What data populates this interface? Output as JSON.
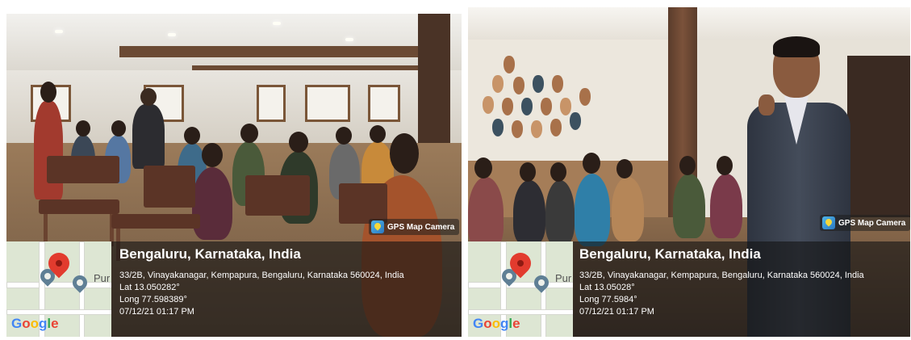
{
  "photos": [
    {
      "gps_tag": "GPS Map Camera",
      "city": "Bengaluru, Karnataka, India",
      "address": "33/2B, Vinayakanagar, Kempapura, Bengaluru, Karnataka 560024, India",
      "lat": "Lat 13.050282°",
      "long": "Long 77.598389°",
      "datetime": "07/12/21 01:17 PM",
      "map_label": "Pur",
      "map_logo": "Google"
    },
    {
      "gps_tag": "GPS Map Camera",
      "city": "Bengaluru, Karnataka, India",
      "address": "33/2B, Vinayakanagar, Kempapura, Bengaluru, Karnataka 560024, India",
      "lat": "Lat 13.05028°",
      "long": "Long 77.5984°",
      "datetime": "07/12/21 01:17 PM",
      "map_label": "Pur",
      "map_logo": "Google"
    }
  ],
  "icons": {
    "gps": "gps-map-camera-icon",
    "pin": "map-pin-icon"
  },
  "colors": {
    "pin_red": "#e23b2e",
    "overlay": "#141414"
  }
}
